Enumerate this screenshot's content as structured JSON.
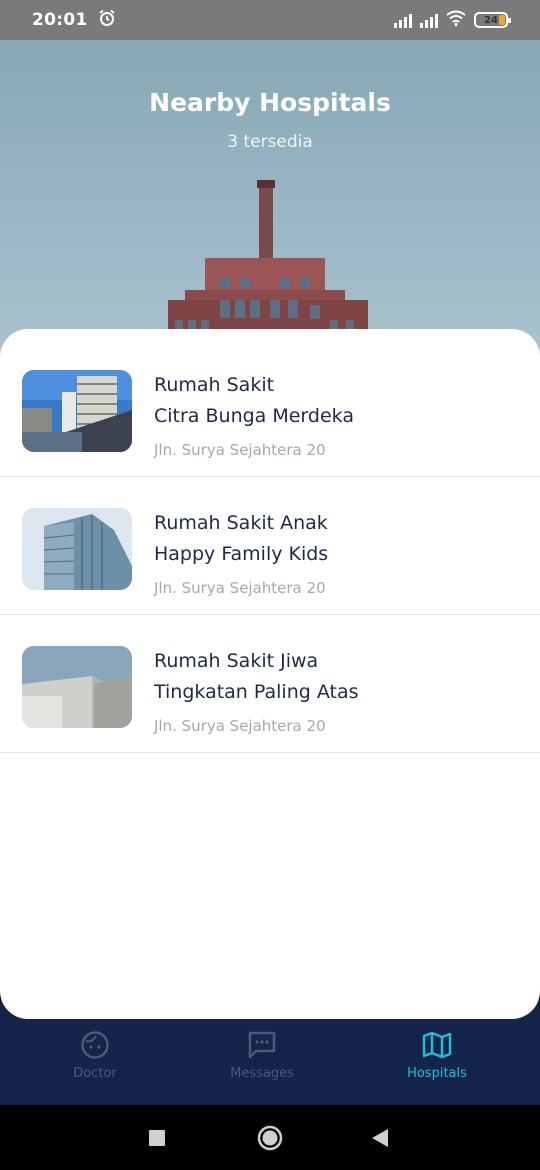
{
  "status": {
    "time": "20:01",
    "battery": "24",
    "icons": [
      "alarm-icon",
      "signal-icon",
      "signal-icon",
      "wifi-icon",
      "battery-icon"
    ]
  },
  "header": {
    "title": "Nearby Hospitals",
    "subtitle": "3 tersedia"
  },
  "hospitals": [
    {
      "name_line1": "Rumah Sakit",
      "name_line2": "Citra Bunga Merdeka",
      "address": "Jln. Surya Sejahtera 20"
    },
    {
      "name_line1": "Rumah Sakit Anak",
      "name_line2": "Happy Family Kids",
      "address": "Jln. Surya Sejahtera 20"
    },
    {
      "name_line1": "Rumah Sakit Jiwa",
      "name_line2": "Tingkatan Paling Atas",
      "address": "Jln. Surya Sejahtera 20"
    }
  ],
  "nav": {
    "items": [
      {
        "label": "Doctor",
        "icon": "face-icon",
        "active": false
      },
      {
        "label": "Messages",
        "icon": "chat-icon",
        "active": false
      },
      {
        "label": "Hospitals",
        "icon": "map-icon",
        "active": true
      }
    ]
  },
  "colors": {
    "nav_bg": "#14244a",
    "nav_active": "#1ec0d6",
    "nav_inactive": "#4a5a7a",
    "title_text": "#1f2a44",
    "sub_text": "#a3a9b3",
    "hero_bg": "#87a8b6"
  },
  "system_nav": [
    "recents-icon",
    "home-icon",
    "back-icon"
  ]
}
